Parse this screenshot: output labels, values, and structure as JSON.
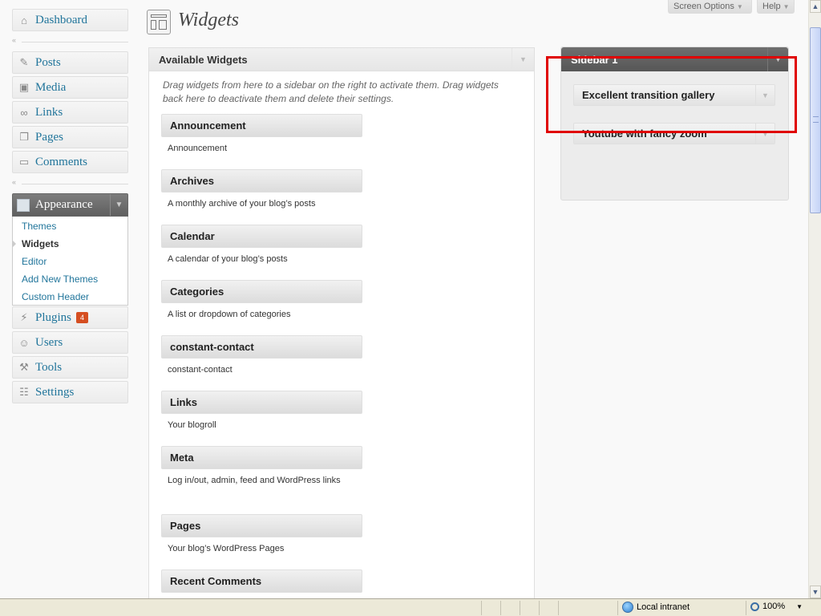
{
  "page": {
    "title": "Widgets",
    "screen_options_label": "Screen Options",
    "help_label": "Help"
  },
  "menu": {
    "dashboard": "Dashboard",
    "posts": "Posts",
    "media": "Media",
    "links": "Links",
    "pages": "Pages",
    "comments": "Comments",
    "appearance": "Appearance",
    "appearance_sub": [
      "Themes",
      "Widgets",
      "Editor",
      "Add New Themes",
      "Custom Header"
    ],
    "plugins": "Plugins",
    "plugins_badge": "4",
    "users": "Users",
    "tools": "Tools",
    "settings": "Settings"
  },
  "available": {
    "title": "Available Widgets",
    "description": "Drag widgets from here to a sidebar on the right to activate them. Drag widgets back here to deactivate them and delete their settings.",
    "widgets": [
      {
        "name": "Announcement",
        "desc": "Announcement"
      },
      {
        "name": "Archives",
        "desc": "A monthly archive of your blog’s posts"
      },
      {
        "name": "Calendar",
        "desc": "A calendar of your blog’s posts"
      },
      {
        "name": "Categories",
        "desc": "A list or dropdown of categories"
      },
      {
        "name": "constant-contact",
        "desc": "constant-contact"
      },
      {
        "name": "Links",
        "desc": "Your blogroll"
      },
      {
        "name": "Meta",
        "desc": "Log in/out, admin, feed and WordPress links"
      },
      {
        "name": "Pages",
        "desc": "Your blog’s WordPress Pages"
      },
      {
        "name": "Recent Comments",
        "desc": ""
      }
    ]
  },
  "sidebar": {
    "title": "Sidebar 1",
    "widgets": [
      "Excellent transition gallery",
      "Youtube with fancy zoom"
    ]
  },
  "statusbar": {
    "zone": "Local intranet",
    "zoom": "100%"
  }
}
